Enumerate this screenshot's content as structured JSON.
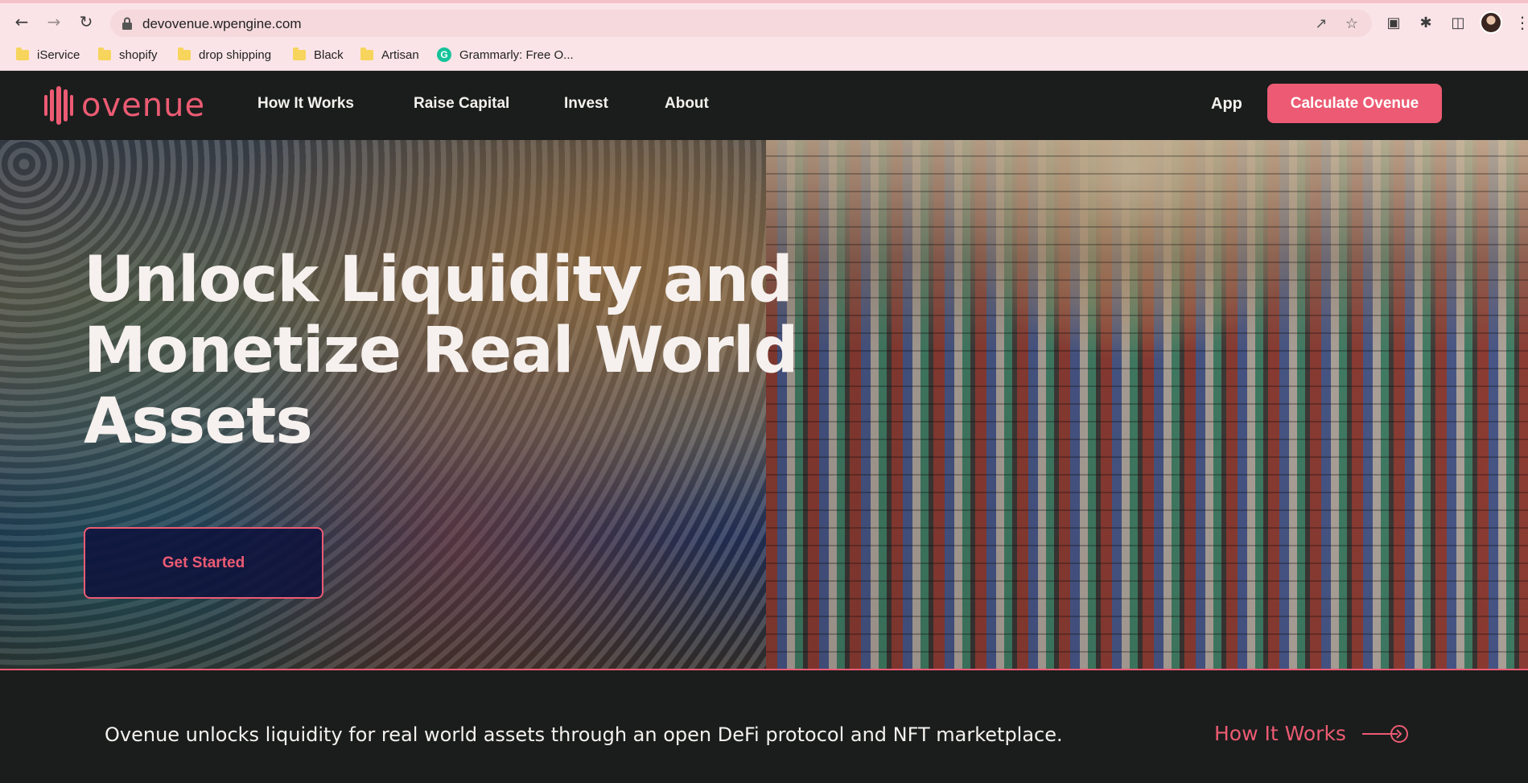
{
  "browser": {
    "url": "devovenue.wpengine.com",
    "bookmarks": [
      {
        "label": "iService",
        "type": "folder"
      },
      {
        "label": "shopify",
        "type": "folder"
      },
      {
        "label": "drop shipping",
        "type": "folder"
      },
      {
        "label": "Black",
        "type": "folder"
      },
      {
        "label": "Artisan",
        "type": "folder"
      },
      {
        "label": "Grammarly: Free O...",
        "type": "grammarly"
      }
    ]
  },
  "header": {
    "logo_text": "ovenue",
    "nav": [
      "How It Works",
      "Raise Capital",
      "Invest",
      "About"
    ],
    "app_label": "App",
    "cta_label": "Calculate Ovenue"
  },
  "hero": {
    "title_lines": [
      "Unlock Liquidity and",
      "Monetize Real World",
      "Assets"
    ],
    "button_label": "Get Started"
  },
  "intro": {
    "text": "Ovenue unlocks liquidity for real world assets through an open DeFi protocol and NFT marketplace.",
    "link_label": "How It Works"
  },
  "colors": {
    "accent": "#ec5b73",
    "dark_bg": "#1a1d1c",
    "chrome_bg": "#fbe4e7"
  }
}
